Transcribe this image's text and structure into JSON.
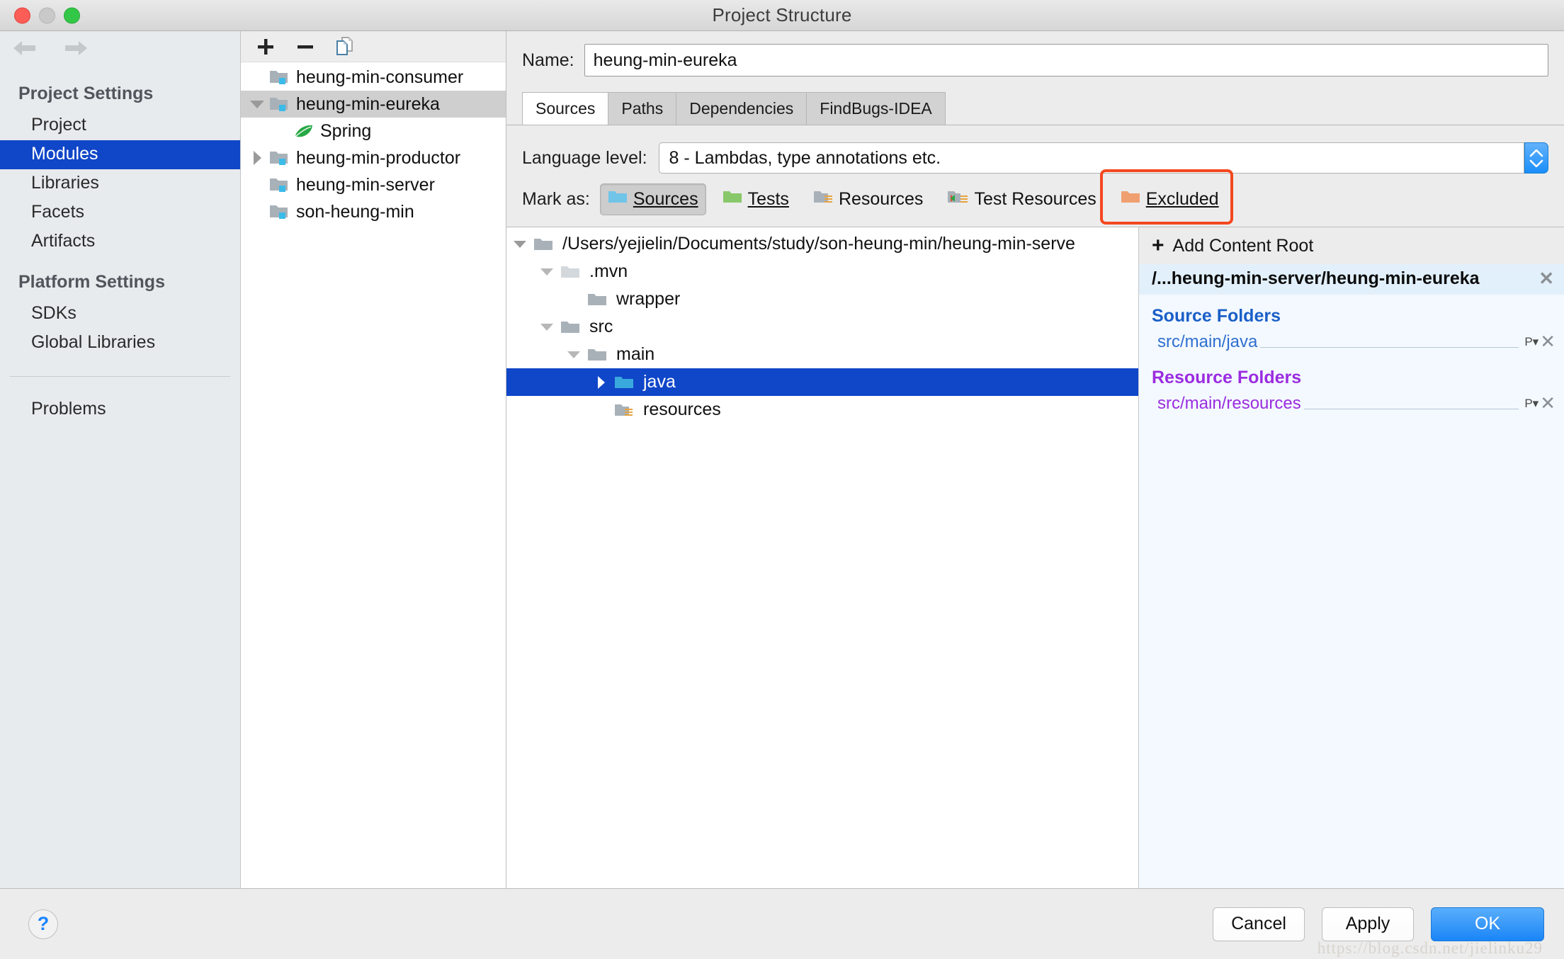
{
  "window": {
    "title": "Project Structure",
    "traffic_lights": [
      "close",
      "minimize",
      "zoom"
    ]
  },
  "sidebar": {
    "nav_back_icon": "arrow-left-icon",
    "nav_forward_icon": "arrow-right-icon",
    "groups": [
      {
        "title": "Project Settings",
        "items": [
          {
            "label": "Project",
            "selected": false
          },
          {
            "label": "Modules",
            "selected": true
          },
          {
            "label": "Libraries",
            "selected": false
          },
          {
            "label": "Facets",
            "selected": false
          },
          {
            "label": "Artifacts",
            "selected": false
          }
        ]
      },
      {
        "title": "Platform Settings",
        "items": [
          {
            "label": "SDKs",
            "selected": false
          },
          {
            "label": "Global Libraries",
            "selected": false
          }
        ]
      }
    ],
    "problems_label": "Problems"
  },
  "module_panel": {
    "toolbar": {
      "add_label": "+",
      "remove_label": "−",
      "copy_label": "copy-icon"
    },
    "tree": [
      {
        "label": "heung-min-consumer",
        "icon": "module-folder-icon",
        "twisty": "none",
        "indent": 1,
        "selected": false
      },
      {
        "label": "heung-min-eureka",
        "icon": "module-folder-icon",
        "twisty": "expanded",
        "indent": 0,
        "selected": true
      },
      {
        "label": "Spring",
        "icon": "spring-leaf-icon",
        "twisty": "none",
        "indent": 2,
        "selected": false
      },
      {
        "label": "heung-min-productor",
        "icon": "module-folder-icon",
        "twisty": "collapsed",
        "indent": 0,
        "selected": false
      },
      {
        "label": "heung-min-server",
        "icon": "module-folder-icon",
        "twisty": "none",
        "indent": 1,
        "selected": false
      },
      {
        "label": "son-heung-min",
        "icon": "module-folder-icon",
        "twisty": "none",
        "indent": 1,
        "selected": false
      }
    ]
  },
  "main": {
    "name_label": "Name:",
    "name_value": "heung-min-eureka",
    "tabs": [
      {
        "label": "Sources",
        "active": true
      },
      {
        "label": "Paths",
        "active": false
      },
      {
        "label": "Dependencies",
        "active": false
      },
      {
        "label": "FindBugs-IDEA",
        "active": false
      }
    ],
    "language_level_label": "Language level:",
    "language_level_value": "8 - Lambdas, type annotations etc.",
    "stepper_icon": "stepper-updown-icon",
    "mark_as_label": "Mark as:",
    "mark_as_buttons": [
      {
        "label": "Sources",
        "mnemonic": "S",
        "icon": "folder-blue-icon",
        "pressed": true,
        "highlighted": true
      },
      {
        "label": "Tests",
        "mnemonic": "T",
        "icon": "folder-green-icon",
        "pressed": false,
        "highlighted": false
      },
      {
        "label": "Resources",
        "mnemonic": "",
        "icon": "folder-resources-icon",
        "pressed": false,
        "highlighted": false
      },
      {
        "label": "Test Resources",
        "mnemonic": "",
        "icon": "folder-test-resources-icon",
        "pressed": false,
        "highlighted": false
      },
      {
        "label": "Excluded",
        "mnemonic": "E",
        "icon": "folder-orange-icon",
        "pressed": false,
        "highlighted": false
      }
    ],
    "file_tree": [
      {
        "label": "/Users/yejielin/Documents/study/son-heung-min/heung-min-serve",
        "icon": "folder-grey-icon",
        "twisty": "expanded",
        "depth": 0,
        "selected": false
      },
      {
        "label": ".mvn",
        "icon": "folder-light-icon",
        "twisty": "expanded",
        "depth": 1,
        "selected": false
      },
      {
        "label": "wrapper",
        "icon": "folder-grey-icon",
        "twisty": "none",
        "depth": 2,
        "selected": false
      },
      {
        "label": "src",
        "icon": "folder-grey-icon",
        "twisty": "expanded",
        "depth": 1,
        "selected": false
      },
      {
        "label": "main",
        "icon": "folder-grey-icon",
        "twisty": "expanded",
        "depth": 2,
        "selected": false
      },
      {
        "label": "java",
        "icon": "folder-blue-icon",
        "twisty": "collapsed",
        "depth": 3,
        "selected": true
      },
      {
        "label": "resources",
        "icon": "folder-resources-icon",
        "twisty": "none",
        "depth": 3,
        "selected": false
      }
    ]
  },
  "content_roots": {
    "add_content_root_label": "Add Content Root",
    "add_icon": "plus-icon",
    "root": {
      "path": "/...heung-min-server/heung-min-eureka",
      "remove_icon": "close-x-icon"
    },
    "sections": [
      {
        "title": "Source Folders",
        "kind": "src",
        "entries": [
          {
            "path": "src/main/java",
            "package_prefix_icon": "package-prefix-icon",
            "remove_icon": "close-x-icon"
          }
        ]
      },
      {
        "title": "Resource Folders",
        "kind": "res",
        "entries": [
          {
            "path": "src/main/resources",
            "package_prefix_icon": "package-prefix-icon",
            "remove_icon": "close-x-icon"
          }
        ]
      }
    ]
  },
  "footer": {
    "help_label": "?",
    "buttons": [
      {
        "label": "Cancel",
        "primary": false
      },
      {
        "label": "Apply",
        "primary": false
      },
      {
        "label": "OK",
        "primary": true
      }
    ],
    "watermark": "https://blog.csdn.net/jielinku29"
  },
  "colors": {
    "selection_blue": "#1046c8",
    "accent_red": "#f4481f",
    "source_folder_blue": "#2f6fd0",
    "resource_folder_purple": "#9b2ce0",
    "primary_button_blue": "#1a85f7"
  }
}
